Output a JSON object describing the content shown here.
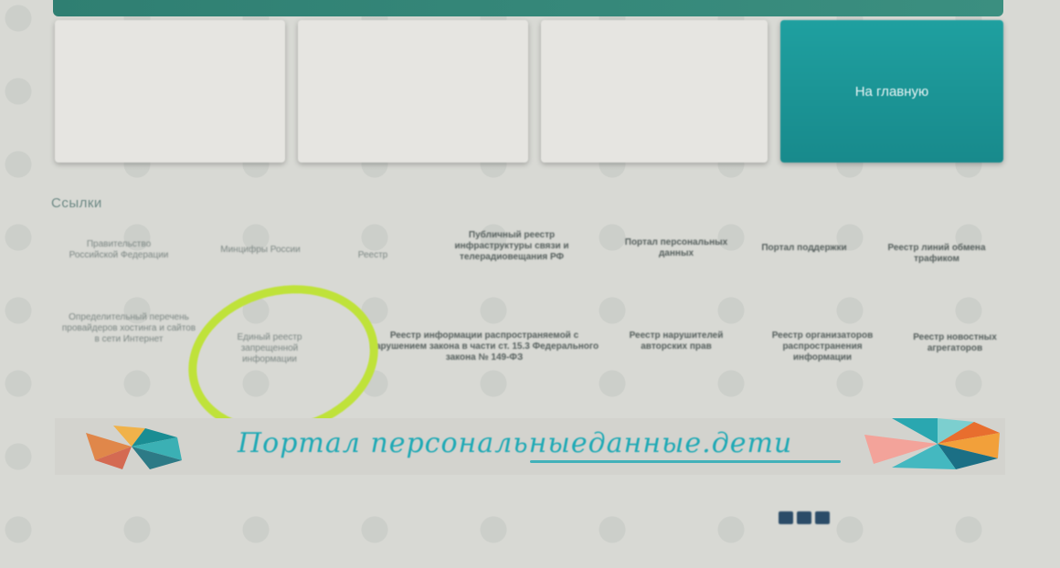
{
  "cards": [
    {
      "date": "",
      "text": ""
    },
    {
      "date": "",
      "text": ""
    },
    {
      "date": "",
      "text": ""
    }
  ],
  "main_card": {
    "label": "На главную"
  },
  "section": {
    "title": "Ссылки"
  },
  "links_row1": [
    {
      "label": "Правительство Российской Федерации"
    },
    {
      "label": "Минцифры России"
    },
    {
      "label": "Реестр"
    },
    {
      "label": "Публичный реестр инфраструктуры связи и телерадиовещания РФ"
    },
    {
      "label": "Портал персональных данных"
    },
    {
      "label": "Портал поддержки"
    },
    {
      "label": "Реестр линий обмена трафиком"
    }
  ],
  "links_row2": [
    {
      "label": "Определительный перечень провайдеров хостинга и сайтов в сети Интернет"
    },
    {
      "label": "Единый реестр запрещенной информации"
    },
    {
      "label": "Реестр информации распространяемой с нарушением закона в части ст. 15.3 Федерального закона № 149-ФЗ"
    },
    {
      "label": "Реестр нарушителей авторских прав"
    },
    {
      "label": "Реестр организаторов распространения информации"
    },
    {
      "label": "Реестр новостных агрегаторов"
    }
  ],
  "banner": {
    "text": "Портал персональныеданные.дети"
  },
  "footer": {
    "org": "",
    "copy": "",
    "copy2": "",
    "link1": "",
    "link2": ""
  },
  "colors": {
    "accent": "#1fa0a0",
    "highlight_circle": "#bfe23a",
    "banner_text": "#1ea9b5"
  }
}
